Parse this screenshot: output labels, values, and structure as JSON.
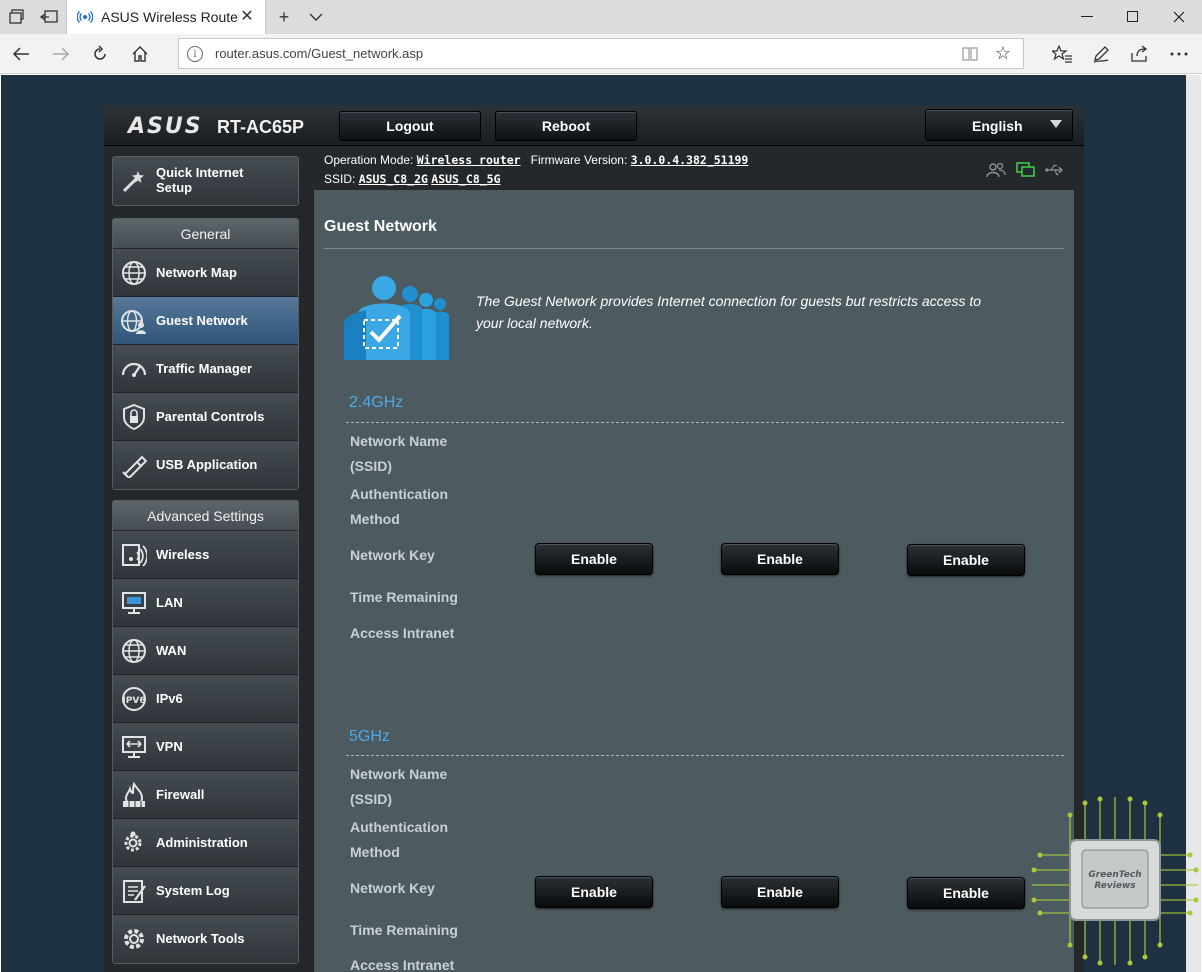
{
  "browser": {
    "tab_title": "ASUS Wireless Router R",
    "url": "router.asus.com/Guest_network.asp"
  },
  "header": {
    "brand": "ASUS",
    "model": "RT-AC65P",
    "logout_label": "Logout",
    "reboot_label": "Reboot",
    "language": "English"
  },
  "status": {
    "op_mode_label": "Operation Mode:",
    "op_mode_value": "Wireless router",
    "firmware_label": "Firmware Version:",
    "firmware_value": "3.0.0.4.382_51199",
    "ssid_label": "SSID:",
    "ssid_2g": "ASUS_C8_2G",
    "ssid_5g": "ASUS_C8_5G"
  },
  "sidebar": {
    "quick_setup": "Quick Internet Setup",
    "general_header": "General",
    "general_items": [
      {
        "label": "Network Map",
        "icon": "network-map-icon"
      },
      {
        "label": "Guest Network",
        "icon": "guest-network-icon",
        "active": true
      },
      {
        "label": "Traffic Manager",
        "icon": "traffic-manager-icon"
      },
      {
        "label": "Parental Controls",
        "icon": "parental-controls-icon"
      },
      {
        "label": "USB Application",
        "icon": "usb-application-icon"
      }
    ],
    "advanced_header": "Advanced Settings",
    "advanced_items": [
      {
        "label": "Wireless",
        "icon": "wireless-icon"
      },
      {
        "label": "LAN",
        "icon": "lan-icon"
      },
      {
        "label": "WAN",
        "icon": "wan-icon"
      },
      {
        "label": "IPv6",
        "icon": "ipv6-icon"
      },
      {
        "label": "VPN",
        "icon": "vpn-icon"
      },
      {
        "label": "Firewall",
        "icon": "firewall-icon"
      },
      {
        "label": "Administration",
        "icon": "administration-icon"
      },
      {
        "label": "System Log",
        "icon": "system-log-icon"
      },
      {
        "label": "Network Tools",
        "icon": "network-tools-icon"
      }
    ]
  },
  "main": {
    "title": "Guest Network",
    "intro": "The Guest Network provides Internet connection for guests but restricts access to your local network.",
    "bands": [
      {
        "name": "2.4GHz",
        "fields": [
          "Network Name (SSID)",
          "Authentication Method",
          "Network Key",
          "Time Remaining",
          "Access Intranet"
        ],
        "buttons": [
          "Enable",
          "Enable",
          "Enable"
        ]
      },
      {
        "name": "5GHz",
        "fields": [
          "Network Name (SSID)",
          "Authentication Method",
          "Network Key",
          "Time Remaining",
          "Access Intranet"
        ],
        "buttons": [
          "Enable",
          "Enable",
          "Enable"
        ]
      }
    ]
  },
  "watermark": {
    "text_line1": "GreenTech",
    "text_line2": "Reviews"
  },
  "colors": {
    "band_title": "#4ea9e6",
    "panel_bg": "#4d5a5f",
    "page_bg": "#1e3140",
    "active_nav": "#3f6a8f"
  }
}
